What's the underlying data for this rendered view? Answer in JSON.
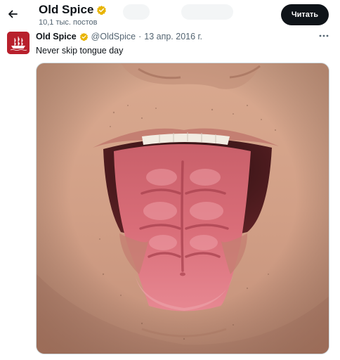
{
  "header": {
    "title": "Old Spice",
    "subtitle": "10,1 тыс. постов",
    "follow_label": "Читать"
  },
  "tweet": {
    "author_name": "Old Spice",
    "handle": "@OldSpice",
    "separator": "·",
    "date": "13 апр. 2016 г.",
    "text": "Never skip tongue day"
  },
  "colors": {
    "verified_badge": "#e8b400",
    "brand_red": "#b8202c",
    "follow_button": "#0f1419"
  },
  "icons": {
    "back": "arrow-left-icon",
    "verified": "verified-badge-icon",
    "more": "more-dots-icon",
    "logo": "ship-logo-icon"
  }
}
